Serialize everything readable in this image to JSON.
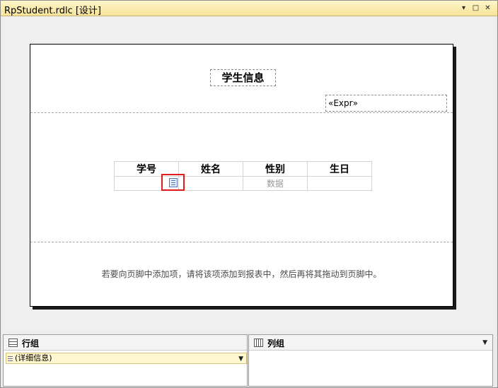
{
  "window": {
    "title": "RpStudent.rdlc [设计]",
    "buttons": [
      "▾",
      "□",
      "✕"
    ]
  },
  "report": {
    "title": "学生信息",
    "expression": "«Expr»",
    "table": {
      "columns": [
        "学号",
        "姓名",
        "性别",
        "生日"
      ],
      "data_row": [
        "",
        "",
        "数据",
        ""
      ]
    },
    "footer_hint": "若要向页脚中添加项，请将该项添加到报表中，然后再将其拖动到页脚中。"
  },
  "panels": {
    "row_groups": {
      "label": "行组",
      "items": [
        "(详细信息)"
      ]
    },
    "column_groups": {
      "label": "列组"
    }
  },
  "colors": {
    "titlebar": "#f7e39a",
    "highlight": "#e01b1b",
    "group_item": "#fff7cf"
  }
}
